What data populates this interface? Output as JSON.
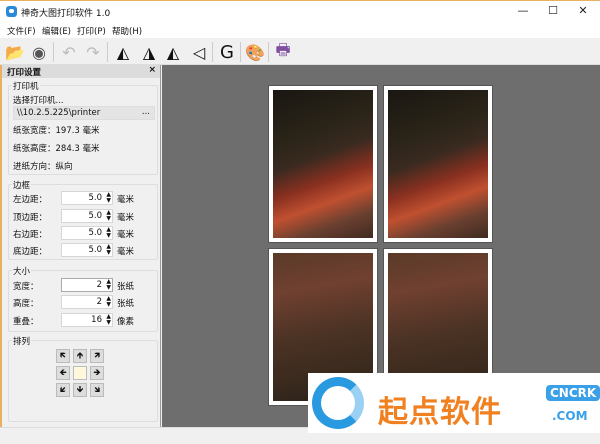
{
  "window": {
    "title": "神奇大图打印软件 1.0",
    "minimize": "—",
    "maximize": "☐",
    "close": "✕"
  },
  "menu": [
    "文件(F)",
    "编辑(E)",
    "打印(P)",
    "帮助(H)"
  ],
  "toolbar": {
    "text_tool": "G"
  },
  "panel": {
    "title": "打印设置",
    "close": "×",
    "printer": {
      "group": "打印机",
      "choose": "选择打印机...",
      "value": "\\\\10.2.5.225\\printer",
      "browse": "...",
      "paper_width": "纸张宽度：197.3 毫米",
      "paper_height": "纸张高度：284.3 毫米",
      "feed": "进纸方向：纵向"
    },
    "margins": {
      "group": "边框",
      "rows": [
        {
          "label": "左边距：",
          "value": "5.0",
          "unit": "毫米"
        },
        {
          "label": "顶边距：",
          "value": "5.0",
          "unit": "毫米"
        },
        {
          "label": "右边距：",
          "value": "5.0",
          "unit": "毫米"
        },
        {
          "label": "底边距：",
          "value": "5.0",
          "unit": "毫米"
        }
      ]
    },
    "size": {
      "group": "大小",
      "rows": [
        {
          "label": "宽度：",
          "value": "2",
          "unit": "张纸"
        },
        {
          "label": "高度：",
          "value": "2",
          "unit": "张纸"
        },
        {
          "label": "重叠：",
          "value": "16",
          "unit": "像素"
        }
      ]
    },
    "arrange": {
      "group": "排列",
      "arrows": [
        "🡼",
        "🡹",
        "🡽",
        "🡸",
        "",
        "🡺",
        "🡿",
        "🡻",
        "🡾"
      ]
    }
  },
  "watermark": {
    "text": "起点软件",
    "badge": "CNCRK",
    "com": ".COM"
  }
}
